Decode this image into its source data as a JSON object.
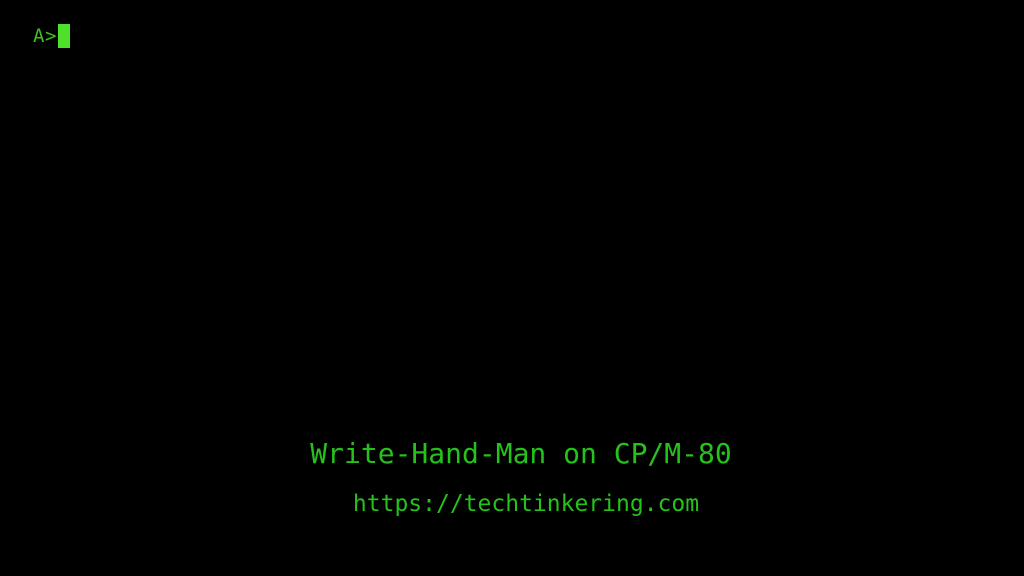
{
  "terminal": {
    "prompt": "A>",
    "cursor": "block-cursor",
    "colors": {
      "background": "#000000",
      "prompt": "#3fbf1f",
      "cursor": "#4ee02a",
      "caption": "#24c21a"
    }
  },
  "caption": {
    "title": "Write-Hand-Man on CP/M-80",
    "url": "https://techtinkering.com"
  }
}
